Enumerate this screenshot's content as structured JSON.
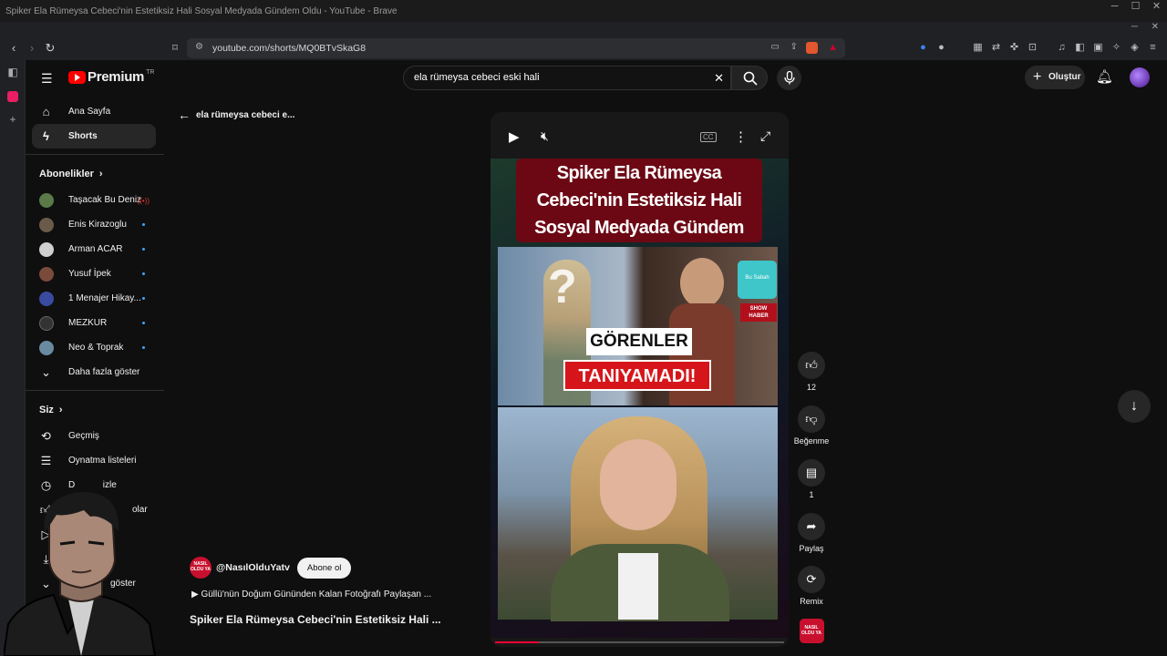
{
  "window": {
    "title": "Spiker Ela Rümeysa Cebeci'nin Estetiksiz Hali Sosyal Medyada Gündem Oldu - YouTube - Brave"
  },
  "browser": {
    "url": "youtube.com/shorts/MQ0BTvSkaG8"
  },
  "youtube": {
    "logo_text": "Premium",
    "logo_badge": "TR",
    "search_value": "ela rümeysa cebeci eski hali",
    "create_label": "Oluştur"
  },
  "sidebar": {
    "main": [
      {
        "label": "Ana Sayfa",
        "icon": "home-icon"
      },
      {
        "label": "Shorts",
        "icon": "shorts-icon"
      }
    ],
    "subs_header": "Abonelikler",
    "subscriptions": [
      {
        "label": "Taşacak Bu Deniz",
        "color": "#5a7a4a"
      },
      {
        "label": "Enis Kirazoglu",
        "color": "#6b5a4a"
      },
      {
        "label": "Arman ACAR",
        "color": "#cfcfcf"
      },
      {
        "label": "Yusuf İpek",
        "color": "#7a4a3a"
      },
      {
        "label": "1 Menajer Hikay...",
        "color": "#3a4aa0"
      },
      {
        "label": "MEZKUR",
        "color": "#333333"
      },
      {
        "label": "Neo & Toprak",
        "color": "#6a8aa0"
      }
    ],
    "show_more": "Daha fazla göster",
    "you_header": "Siz",
    "you_items": [
      {
        "label": "Geçmiş",
        "icon": "history-icon"
      },
      {
        "label": "Oynatma listeleri",
        "icon": "playlist-icon"
      },
      {
        "label": "D           izle",
        "icon": "clock-icon"
      },
      {
        "label": "olar",
        "icon": "like-icon"
      },
      {
        "label": "",
        "icon": "video-icon"
      },
      {
        "label": "",
        "icon": "download-icon"
      },
      {
        "label": "göster",
        "icon": "chevron-down-icon"
      }
    ]
  },
  "back_label": "ela rümeysa cebeci e...",
  "video": {
    "headline": "Spiker Ela Rümeysa Cebeci'nin Estetiksiz Hali Sosyal Medyada Gündem Oldu",
    "tag1": "GÖRENLER",
    "tag2": "TANIYAMADI!",
    "inset_brand": "Bu Sabah",
    "inset_show": "SHOW HABER",
    "progress_fraction": 0.15
  },
  "actions": {
    "likes": "12",
    "dislike_label": "Beğenme",
    "comments": "1",
    "share_label": "Paylaş",
    "remix_label": "Remix"
  },
  "channel": {
    "handle": "@NasılOlduYatv",
    "avatar_text": "NASIL OLDU YA",
    "subscribe_label": "Abone ol",
    "playlist_text": "▶ Güllü'nün Doğum Gününden Kalan Fotoğrafı Paylaşan ...",
    "video_title": "Spiker Ela Rümeysa Cebeci'nin Estetiksiz Hali ..."
  }
}
